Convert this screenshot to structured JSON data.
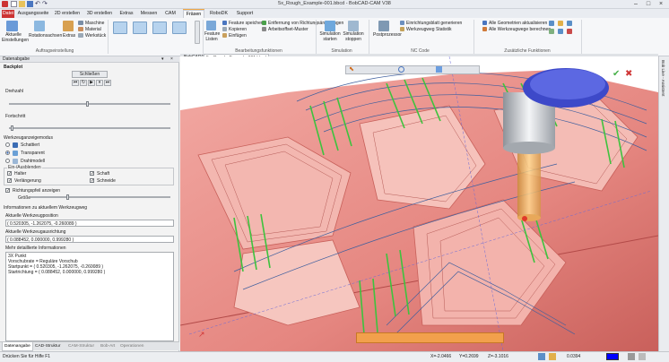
{
  "window": {
    "title": "5x_Rough_Example-001.bbcd - BobCAD-CAM V38",
    "controls": [
      "minimize-icon",
      "maximize-icon",
      "close-icon"
    ]
  },
  "menu": {
    "context_tab": "Simulation",
    "tabs": [
      "Datei",
      "Ausgangsseite",
      "2D erstellen",
      "3D erstellen",
      "Extras",
      "Messen",
      "CAM",
      "Fräsen",
      "RoboDK",
      "Support"
    ],
    "active_index": 7
  },
  "ribbon": {
    "groups": {
      "setup": "Auftragseinstellung",
      "editing": "Bearbeitungsfunktionen",
      "simulation": "Simulation",
      "nccode": "NC Code",
      "extra": "Zusätzliche Funktionen"
    },
    "buttons": {
      "current_settings": "Aktuelle Einstellungen",
      "rotation_axes": "Rotationsachsen",
      "extras": "Extras",
      "machine": "Maschine",
      "material": "Material",
      "workpiece": "Werkstück",
      "features": "Feature Listen",
      "save_feature": "Feature speichern",
      "copy": "Kopieren",
      "paste": "Einfügen",
      "remove_direction": "Entfernung von Richtungsänderungen",
      "work_pattern": "Arbeitsoffset-Muster",
      "sim_start": "Simulation starten",
      "sim_stop": "Simulation stoppen",
      "postprocessor": "Postprozessor",
      "nc_generate": "Einrichtungsblatt generieren",
      "tool_stats": "Werkzeugweg Statistik",
      "update_geometry": "Alle Geometrien aktualisieren",
      "compute_toolpaths": "Alle Werkzeugwege berechnen"
    }
  },
  "left_panel": {
    "header": "Datenabgabe",
    "section_title": "Backplot",
    "close_button": "Schließen",
    "playback": [
      "skip-back-icon",
      "loop-icon",
      "play-icon",
      "pause-icon",
      "skip-forward-icon"
    ],
    "speed_label": "Drehzahl",
    "progress_label": "Fortschritt",
    "tool_mode_label": "Werkzeuganzeigemodus",
    "tool_modes": [
      "Schattiert",
      "Transparent",
      "Drahtmodell"
    ],
    "tool_mode_selected": 1,
    "visibility_label": "Ein-/Ausblenden",
    "visibility": [
      {
        "label": "Halter",
        "checked": true
      },
      {
        "label": "Schaft",
        "checked": true
      },
      {
        "label": "Verlängerung",
        "checked": true
      },
      {
        "label": "Schneide",
        "checked": true
      }
    ],
    "direction_arrow_label": "Richtungspfeil anzeigen",
    "direction_arrow_checked": true,
    "size_label": "Größe",
    "info_header": "Informationen zu aktuellem Werkzeugweg",
    "current_pos_label": "Aktuelle Werkzeugposition",
    "current_pos_value": "( 0.520305, -1.262075, -0.260089 )",
    "current_dir_label": "Aktuelle Werkzeugausrichtung",
    "current_dir_value": "( 0.088452, 0.000000, 0.999280 )",
    "details_label": "Mehr detaillierte Informationen",
    "details_lines": [
      "3X Punkt",
      "Vorschubrate = Reguläre Vorschub",
      "Startpunkt = ( 0.520305, -1.262075, -0.260089 )",
      "Startrichtung = ( 0.088452, 0.000000, 0.999280 )"
    ],
    "bottom_tabs": [
      "Datenangabe",
      "CAD-Struktur",
      "CAM-Struktur",
      "Bob-Art",
      "Operationen"
    ],
    "bottom_tab_active": 0
  },
  "document_tabs": [
    "BobCAD1",
    "5x_Rough_Example-001.bbcd"
  ],
  "document_tab_active": 1,
  "right_strip": [
    "Bob Live - Assistent"
  ],
  "status": {
    "hint": "Drücken Sie für Hilfe F1",
    "x": "X=-2.0466",
    "y": "Y=0.2699",
    "z": "Z=-3.1016",
    "color_value": "0.0394"
  },
  "colors": {
    "part": "#e88a86",
    "part_dark": "#b94b4b",
    "toolpath_green": "#3ec23e",
    "toolpath_blue": "#3f5f9e",
    "tool_holder": "#4a5ad8",
    "tool_cutter": "#f0b860",
    "accent": "#f0a848"
  }
}
